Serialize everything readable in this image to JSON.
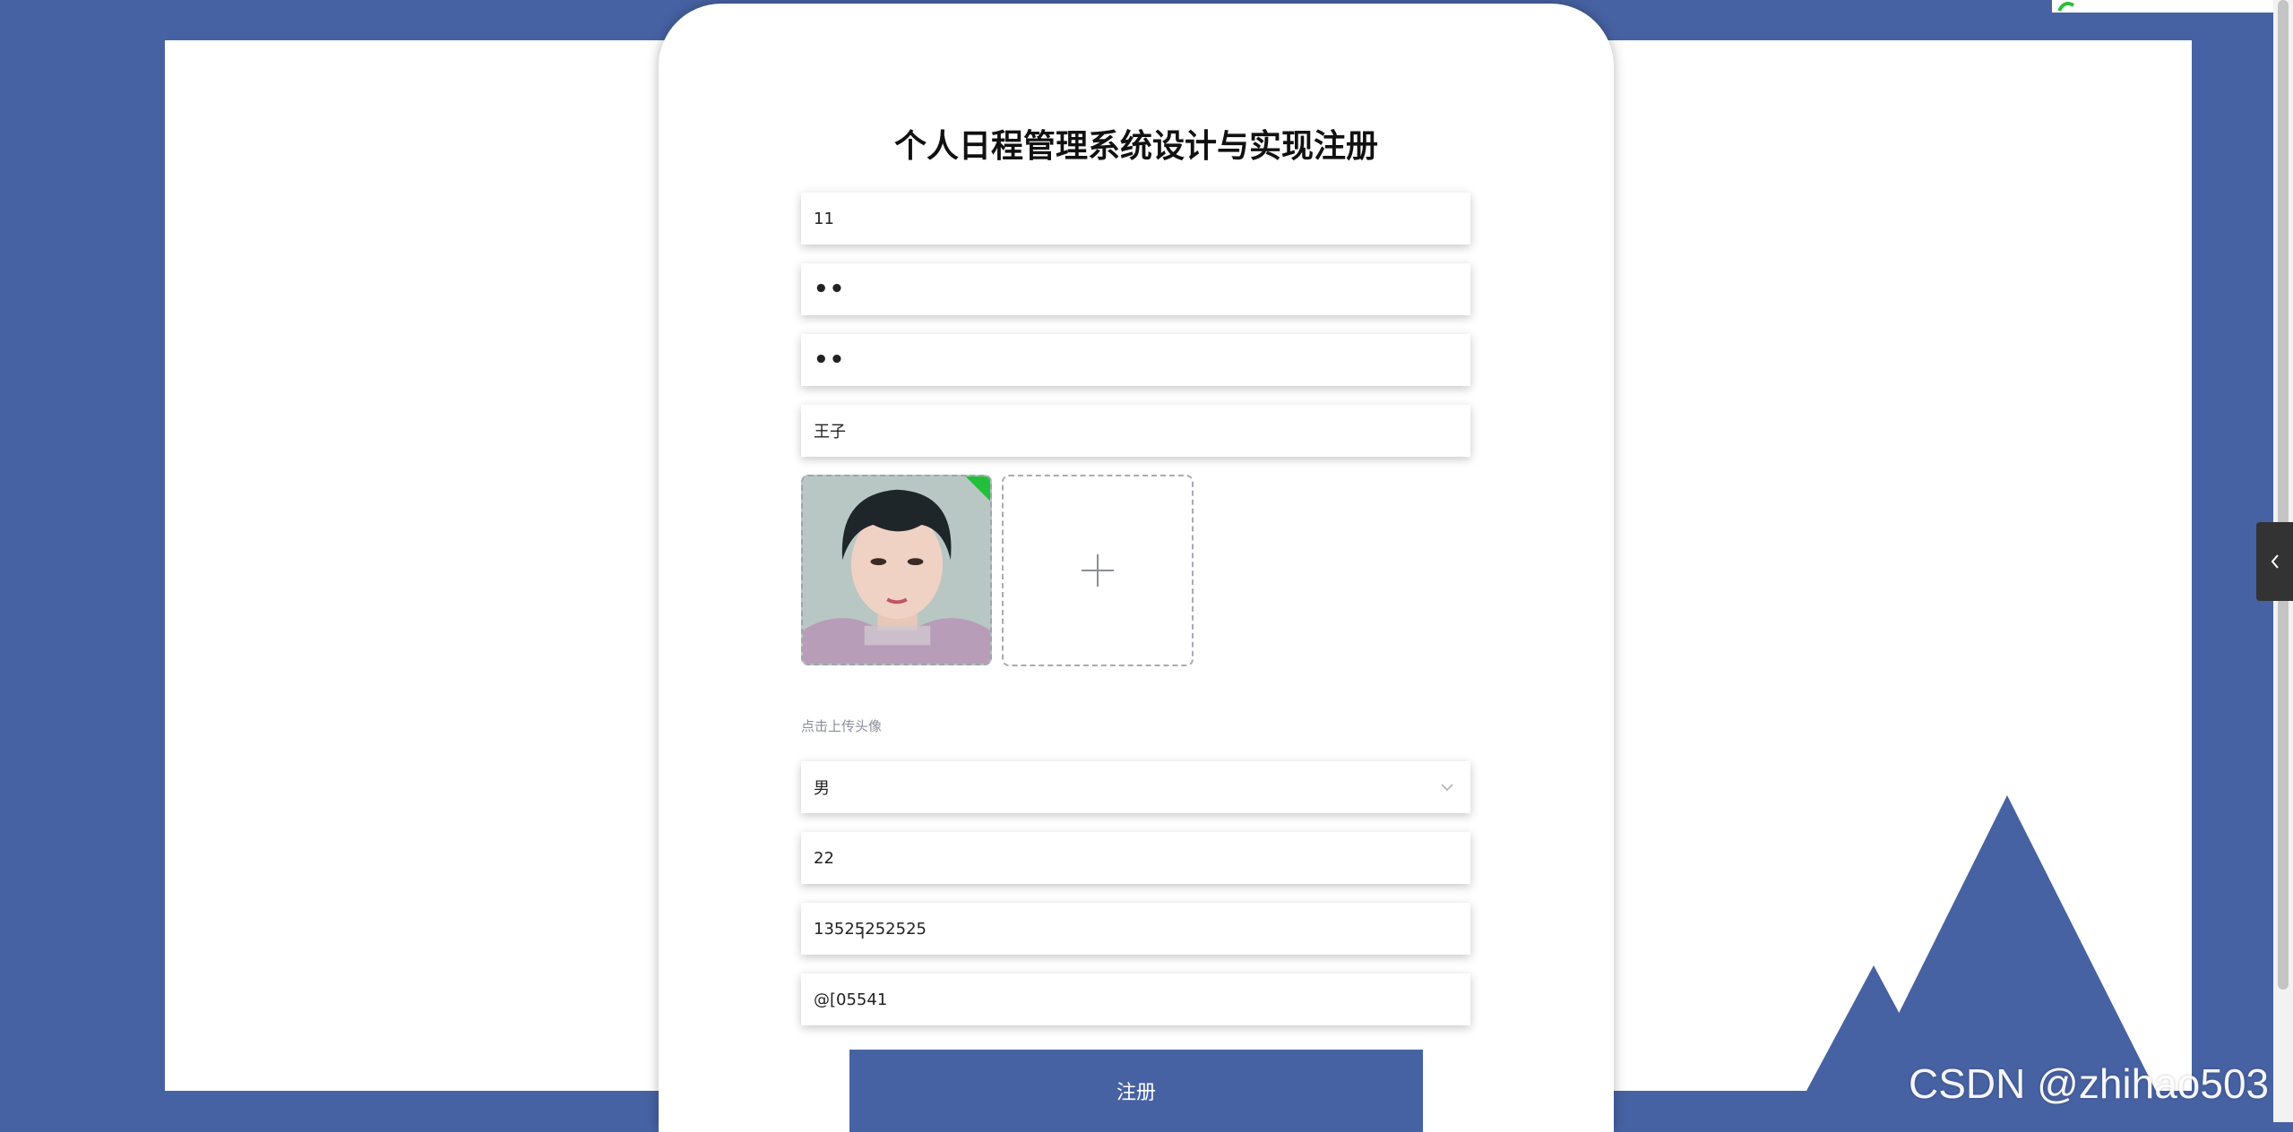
{
  "form": {
    "title": "个人日程管理系统设计与实现注册",
    "username": "11",
    "password": "••",
    "confirm_password": "••",
    "name": "王子",
    "upload_hint": "点击上传头像",
    "gender": "男",
    "age": "22",
    "phone": "13525252525",
    "email": "@[05541",
    "submit_label": "注册"
  },
  "watermark": "CSDN @zhihao503",
  "colors": {
    "brand": "#4762a3",
    "panel": "#ffffff"
  },
  "icons": {
    "upload": "plus-icon",
    "select": "chevron-down-icon",
    "collapse": "chevron-left-icon"
  }
}
